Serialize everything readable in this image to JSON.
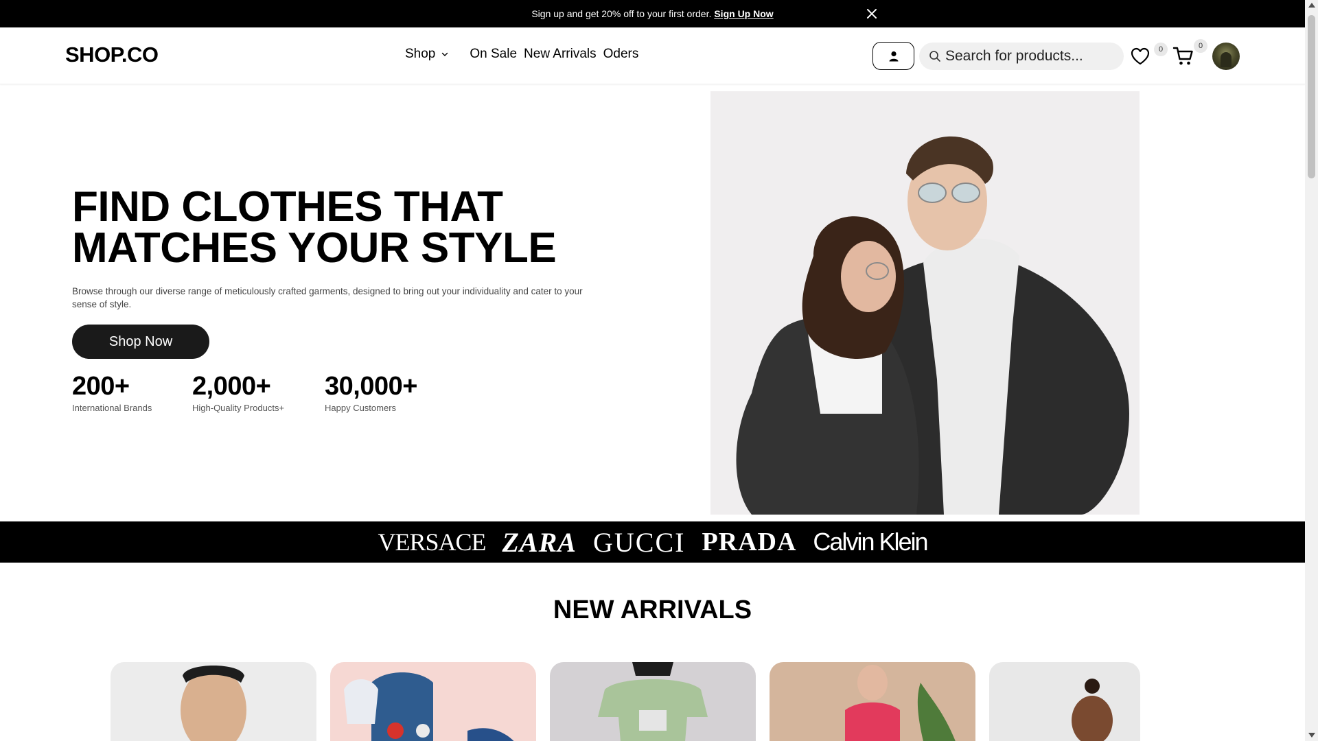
{
  "promo": {
    "text": "Sign up and get 20% off to your first order.",
    "link": "Sign Up Now"
  },
  "header": {
    "logo": "SHOP.CO",
    "nav": [
      {
        "label": "Shop"
      },
      {
        "label": "On Sale"
      },
      {
        "label": "New Arrivals"
      },
      {
        "label": "Oders"
      }
    ],
    "search_placeholder": "Search for products...",
    "wishlist_count": "0",
    "cart_count": "0"
  },
  "hero": {
    "title_line1": "FIND CLOTHES THAT",
    "title_line2": "MATCHES YOUR STYLE",
    "description": "Browse through our diverse range of meticulously crafted garments, designed to bring out your individuality and cater to your sense of style.",
    "cta": "Shop Now",
    "stats": [
      {
        "value": "200+",
        "label": "International Brands"
      },
      {
        "value": "2,000+",
        "label": "High-Quality Products+"
      },
      {
        "value": "30,000+",
        "label": "Happy Customers"
      }
    ]
  },
  "brands": [
    "VERSACE",
    "ZARA",
    "GUCCI",
    "PRADA",
    "Calvin Klein"
  ],
  "new_arrivals": {
    "title": "NEW ARRIVALS"
  },
  "colors": {
    "primary": "#000000",
    "button": "#1a1a1a",
    "search_bg": "#f0f0f0",
    "hero_image_bg": "#f0eeef"
  }
}
